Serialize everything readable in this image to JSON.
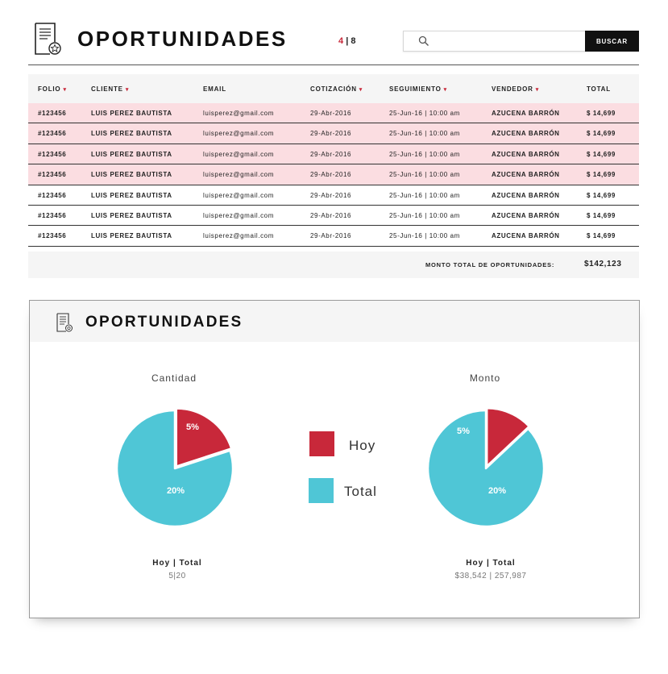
{
  "header": {
    "title": "OPORTUNIDADES",
    "page_current": "4",
    "page_sep": "|",
    "page_total": "8",
    "search_value": "",
    "search_button": "BUSCAR"
  },
  "table": {
    "columns": [
      {
        "label": "FOLIO",
        "sortable": true
      },
      {
        "label": "CLIENTE",
        "sortable": true
      },
      {
        "label": "EMAIL",
        "sortable": false
      },
      {
        "label": "COTIZACIÓN",
        "sortable": true
      },
      {
        "label": "SEGUIMIENTO",
        "sortable": true
      },
      {
        "label": "VENDEDOR",
        "sortable": true
      },
      {
        "label": "TOTAL",
        "sortable": false
      }
    ],
    "rows": [
      {
        "highlight": true,
        "folio": "#123456",
        "cliente": "LUIS PEREZ BAUTISTA",
        "email": "luisperez@gmail.com",
        "cotizacion": "29-Abr-2016",
        "seguimiento": "25-Jun-16 | 10:00 am",
        "vendedor": "AZUCENA BARRÓN",
        "total": "$ 14,699"
      },
      {
        "highlight": true,
        "folio": "#123456",
        "cliente": "LUIS PEREZ BAUTISTA",
        "email": "luisperez@gmail.com",
        "cotizacion": "29-Abr-2016",
        "seguimiento": "25-Jun-16 | 10:00 am",
        "vendedor": "AZUCENA BARRÓN",
        "total": "$ 14,699"
      },
      {
        "highlight": true,
        "folio": "#123456",
        "cliente": "LUIS PEREZ BAUTISTA",
        "email": "luisperez@gmail.com",
        "cotizacion": "29-Abr-2016",
        "seguimiento": "25-Jun-16 | 10:00 am",
        "vendedor": "AZUCENA BARRÓN",
        "total": "$ 14,699"
      },
      {
        "highlight": true,
        "folio": "#123456",
        "cliente": "LUIS PEREZ BAUTISTA",
        "email": "luisperez@gmail.com",
        "cotizacion": "29-Abr-2016",
        "seguimiento": "25-Jun-16 | 10:00 am",
        "vendedor": "AZUCENA BARRÓN",
        "total": "$ 14,699"
      },
      {
        "highlight": false,
        "folio": "#123456",
        "cliente": "LUIS PEREZ BAUTISTA",
        "email": "luisperez@gmail.com",
        "cotizacion": "29-Abr-2016",
        "seguimiento": "25-Jun-16 | 10:00 am",
        "vendedor": "AZUCENA BARRÓN",
        "total": "$ 14,699"
      },
      {
        "highlight": false,
        "folio": "#123456",
        "cliente": "LUIS PEREZ BAUTISTA",
        "email": "luisperez@gmail.com",
        "cotizacion": "29-Abr-2016",
        "seguimiento": "25-Jun-16 | 10:00 am",
        "vendedor": "AZUCENA BARRÓN",
        "total": "$ 14,699"
      },
      {
        "highlight": false,
        "folio": "#123456",
        "cliente": "LUIS PEREZ BAUTISTA",
        "email": "luisperez@gmail.com",
        "cotizacion": "29-Abr-2016",
        "seguimiento": "25-Jun-16 | 10:00 am",
        "vendedor": "AZUCENA BARRÓN",
        "total": "$ 14,699"
      }
    ],
    "total_label": "MONTO TOTAL DE  OPORTUNIDADES:",
    "total_value": "$142,123"
  },
  "chart_panel": {
    "title": "OPORTUNIDADES",
    "legend": [
      {
        "label": "Hoy",
        "color": "#c8283a"
      },
      {
        "label": "Total",
        "color": "#4fc6d6"
      }
    ],
    "summaries": [
      {
        "label": "Hoy | Total",
        "value": "5|20"
      },
      {
        "label": "Hoy | Total",
        "value": "$38,542 | 257,987"
      }
    ]
  },
  "colors": {
    "accent_red": "#c8283a",
    "highlight_row": "#fbdde1",
    "pie_cyan": "#4fc6d6",
    "pie_red": "#c8283a"
  },
  "chart_data": [
    {
      "type": "pie",
      "title": "Cantidad",
      "slices": [
        {
          "label": "Hoy",
          "value": 5,
          "display": "5%",
          "color": "#c8283a"
        },
        {
          "label": "Total",
          "value": 20,
          "display": "20%",
          "color": "#4fc6d6"
        }
      ]
    },
    {
      "type": "pie",
      "title": "Monto",
      "slices": [
        {
          "label": "Hoy",
          "value": 38542,
          "display": "5%",
          "color": "#c8283a"
        },
        {
          "label": "Total",
          "value": 257987,
          "display": "20%",
          "color": "#4fc6d6"
        }
      ]
    }
  ]
}
